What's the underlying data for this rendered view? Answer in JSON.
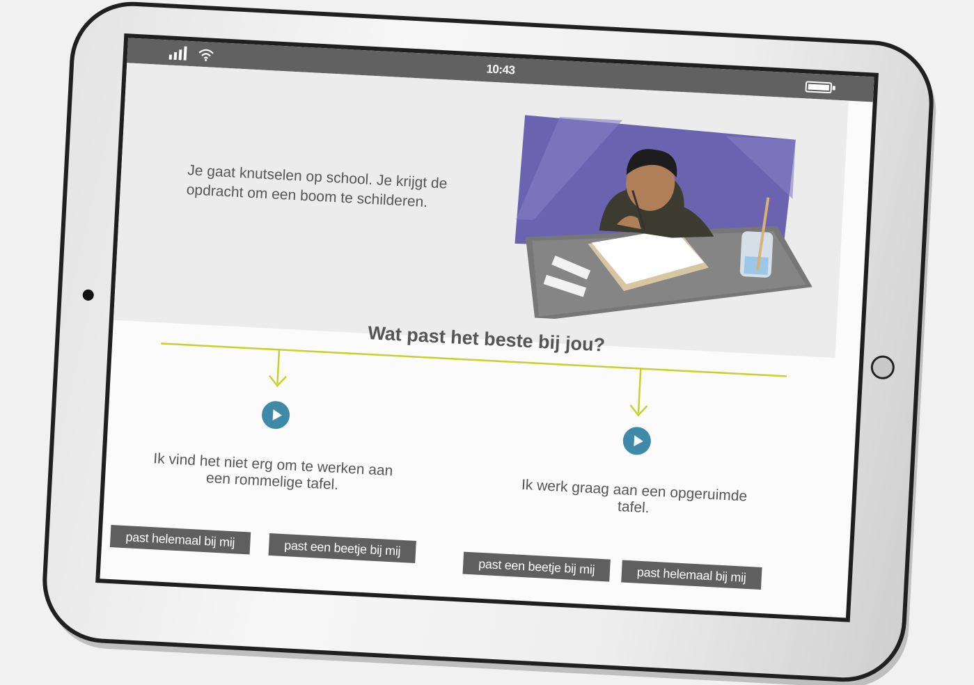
{
  "status": {
    "time": "10:43"
  },
  "intro": {
    "text": "Je gaat knutselen op school. Je krijgt de opdracht om een boom te schilderen."
  },
  "question": "Wat past het beste bij jou?",
  "choices": [
    {
      "text": "Ik vind het niet erg om te werken aan een rommelige tafel.",
      "buttons": [
        "past helemaal bij mij",
        "past een beetje bij mij"
      ]
    },
    {
      "text": "Ik werk graag aan een opgeruimde tafel.",
      "buttons": [
        "past een beetje bij mij",
        "past helemaal bij mij"
      ]
    }
  ],
  "colors": {
    "accent_line": "#c5d22a",
    "play_button": "#3f8aa8",
    "answer_button": "#5f5f5f",
    "illustration_bg": "#6b63b0"
  },
  "icons": [
    "signal-icon",
    "wifi-icon",
    "battery-icon",
    "play-icon"
  ]
}
